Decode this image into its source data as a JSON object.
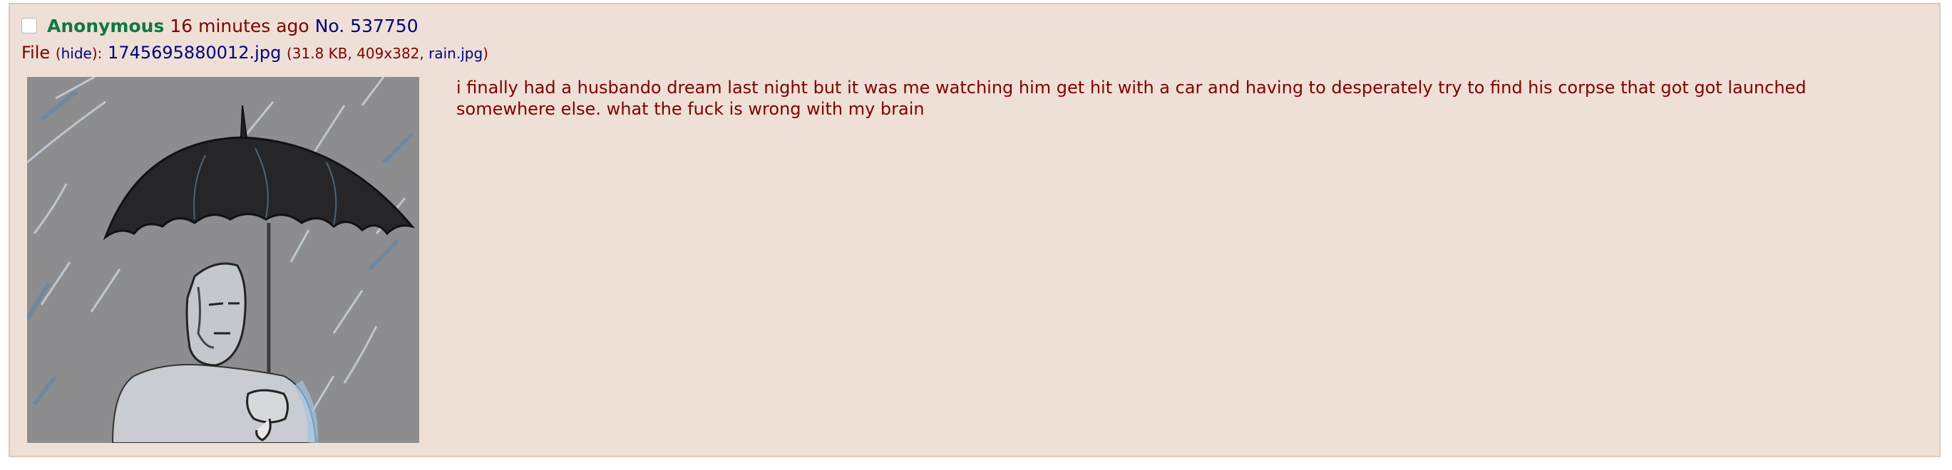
{
  "post": {
    "name": "Anonymous",
    "date": "16 minutes ago",
    "number": "No. 537750",
    "file": {
      "prefix": "File",
      "hide_open": "(",
      "hide_label": "hide",
      "hide_close": "):",
      "filename": "1745695880012.jpg",
      "meta_open": "(31.8 KB, 409x382,",
      "original_name": "rain.jpg",
      "meta_close": ")"
    },
    "comment": "i finally had a husbando dream last night but it was me watching him get hit with a car and having to desperately try to find his corpse that got got launched somewhere else. what the fuck is wrong with my brain"
  },
  "colors": {
    "post_background": "#eee0d6",
    "name": "#117743",
    "text": "#800000",
    "link": "#000080"
  }
}
